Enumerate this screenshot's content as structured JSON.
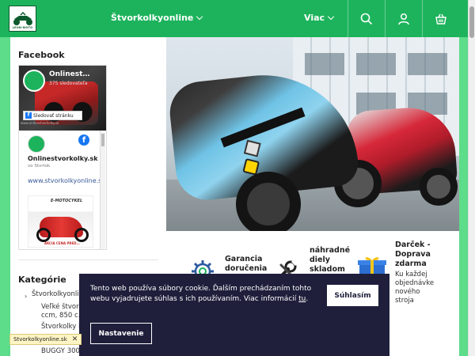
{
  "header": {
    "logo_text": "LEON-MOTO",
    "nav": [
      {
        "label": "Štvorkolkyonline"
      },
      {
        "label": "Viac"
      }
    ]
  },
  "sidebar": {
    "facebook_heading": "Facebook",
    "fb_widget": {
      "page_name": "Onlinest…",
      "followers": "375 sledovateľa",
      "follow_button": "Sledovať stránku",
      "cover_url": "www.onlinestvorkolky.sk",
      "post_name": "Onlinestvorkolky.sk",
      "post_sub": "vo Stvrtok",
      "post_link": "www.stvorkolkyonline.sk",
      "post_image_title": "E-MOTOCYKEL",
      "post_image_price": "AKCIA CENA PRED..."
    },
    "kategorie_heading": "Kategórie",
    "categories": [
      {
        "label": "Štvorkolkyonline"
      },
      {
        "label": "Veľké štvork…"
      },
      {
        "label": "ccm, 850 c…"
      },
      {
        "label": "Štvorkolky F…"
      },
      {
        "label": "BUGGY 300c…"
      }
    ]
  },
  "features": [
    {
      "title_lines": [
        "Garancia",
        "doručenia"
      ],
      "icon": "gear-icon"
    },
    {
      "title_lines": [
        "náhradné",
        "diely",
        "skladom"
      ],
      "icon": "wrench-icon"
    },
    {
      "title_lines": [
        "Darček -",
        "Doprava",
        "zdarma"
      ],
      "sub_lines": [
        "Ku každej",
        "objednávke",
        "nového",
        "stroja"
      ],
      "icon": "gift-icon"
    }
  ],
  "cookie": {
    "text_before_link": "Tento web používa súbory cookie. Ďalším prechádzaním tohto webu vyjadrujete súhlas s ich používaním. Viac informácií ",
    "link": "tu",
    "text_after_link": ".",
    "accept": "Súhlasím",
    "settings": "Nastavenie"
  },
  "tooltip": {
    "text": "Stvorkolkyonline.sk",
    "close": "✕"
  },
  "colors": {
    "brand_green": "#1db35c",
    "side_green": "#5ddc8a",
    "cookie_bg": "#1f1f3c",
    "fb_blue": "#1877f2"
  }
}
